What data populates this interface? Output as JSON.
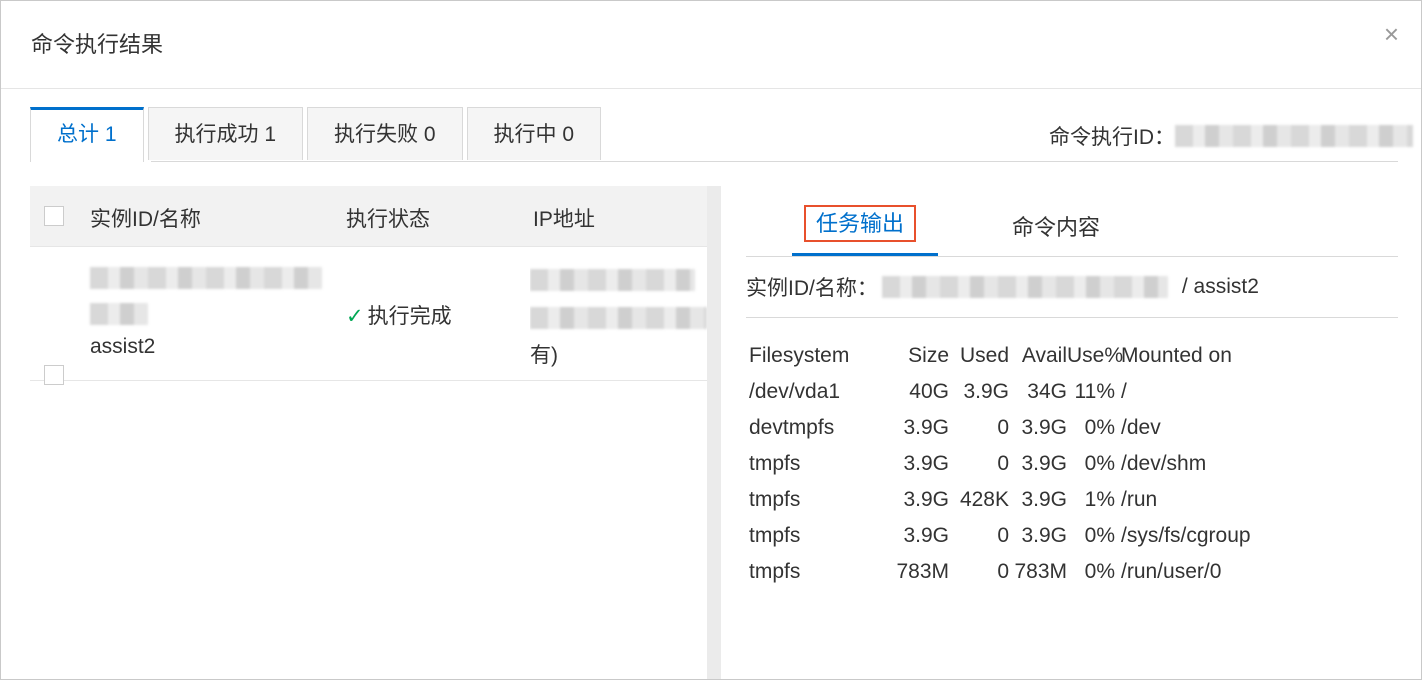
{
  "dialog": {
    "title": "命令执行结果",
    "close_glyph": "×"
  },
  "tabs": [
    {
      "label": "总计 1",
      "active": true
    },
    {
      "label": "执行成功 1",
      "active": false
    },
    {
      "label": "执行失败 0",
      "active": false
    },
    {
      "label": "执行中 0",
      "active": false
    }
  ],
  "exec_id": {
    "label": "命令执行ID："
  },
  "table": {
    "headers": {
      "name": "实例ID/名称",
      "status": "执行状态",
      "ip": "IP地址"
    },
    "rows": [
      {
        "name": "assist2",
        "status": "执行完成",
        "status_icon": "check-icon",
        "ip_suffix": "有)"
      }
    ]
  },
  "detail": {
    "sub_tabs": [
      {
        "label": "任务输出",
        "active": true
      },
      {
        "label": "命令内容",
        "active": false
      }
    ],
    "instance_label": "实例ID/名称：",
    "instance_name": "/ assist2",
    "output_lines": [
      [
        "Filesystem",
        "Size",
        "Used",
        "Avail",
        "Use%",
        "Mounted on"
      ],
      [
        "/dev/vda1",
        "40G",
        "3.9G",
        "34G",
        "11%",
        "/"
      ],
      [
        "devtmpfs",
        "3.9G",
        "0",
        "3.9G",
        "0%",
        "/dev"
      ],
      [
        "tmpfs",
        "3.9G",
        "0",
        "3.9G",
        "0%",
        "/dev/shm"
      ],
      [
        "tmpfs",
        "3.9G",
        "428K",
        "3.9G",
        "1%",
        "/run"
      ],
      [
        "tmpfs",
        "3.9G",
        "0",
        "3.9G",
        "0%",
        "/sys/fs/cgroup"
      ],
      [
        "tmpfs",
        "783M",
        "0",
        "783M",
        "0%",
        "/run/user/0"
      ]
    ]
  },
  "colors": {
    "accent": "#0070cc",
    "highlight": "#e8502c",
    "success": "#00a854"
  }
}
